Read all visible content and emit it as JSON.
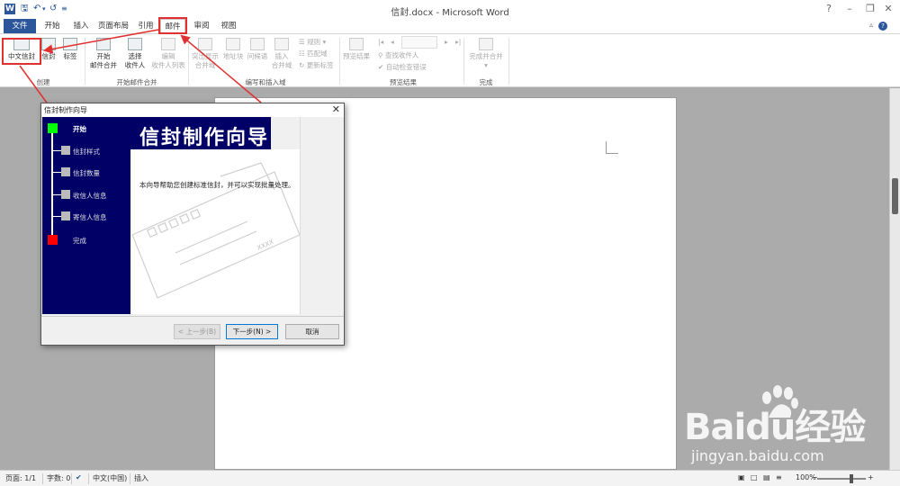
{
  "window": {
    "title": "信封.docx - Microsoft Word",
    "app_icon": "W",
    "qat": [
      "save-icon",
      "undo-icon",
      "redo-icon",
      "customize-icon"
    ]
  },
  "tabs": [
    {
      "label": "文件"
    },
    {
      "label": "开始"
    },
    {
      "label": "插入"
    },
    {
      "label": "页面布局"
    },
    {
      "label": "引用"
    },
    {
      "label": "邮件"
    },
    {
      "label": "审阅"
    },
    {
      "label": "视图"
    }
  ],
  "ribbon": {
    "create": {
      "group": "创建",
      "chinese_envelope": "中文信封",
      "envelope": "信封",
      "labels": "标签"
    },
    "start_merge": {
      "group": "开始邮件合并",
      "start_mail_merge": [
        "开始",
        "邮件合并"
      ],
      "select_recipients": [
        "选择",
        "收件人"
      ],
      "edit_recipients": [
        "编辑",
        "收件人列表"
      ]
    },
    "write_insert": {
      "group": "编写和插入域",
      "highlight_fields": [
        "突出显示",
        "合并域"
      ],
      "address_block": "地址块",
      "greeting_line": "问候语",
      "insert_merge_field": [
        "插入",
        "合并域"
      ],
      "rules": "规则",
      "match_fields": "匹配域",
      "update_labels": "更新标签"
    },
    "preview": {
      "group": "预览结果",
      "preview_results": "预览结果",
      "find_recipient": "查找收件人",
      "auto_check": "自动检查错误"
    },
    "finish": {
      "group": "完成",
      "finish_merge": [
        "完成并合并"
      ]
    }
  },
  "dialog": {
    "title": "信封制作向导",
    "banner": "信封制作向导",
    "steps": [
      "开始",
      "信封样式",
      "信封数量",
      "收信人信息",
      "寄信人信息",
      "完成"
    ],
    "description": "本向导帮助您创建标准信封，并可以实现批量处理。",
    "envelope_stamp": "XXXX",
    "buttons": {
      "back": "< 上一步(B)",
      "next": "下一步(N) >",
      "cancel": "取消"
    }
  },
  "status": {
    "page": "页面: 1/1",
    "words": "字数: 0",
    "language": "中文(中国)",
    "mode": "插入",
    "zoom": "100%"
  },
  "watermark": {
    "brand": "Baidu经验",
    "url": "jingyan.baidu.com"
  },
  "colors": {
    "accent": "#2b579a",
    "dialog_panel": "#000066",
    "annotation": "#e03030"
  }
}
